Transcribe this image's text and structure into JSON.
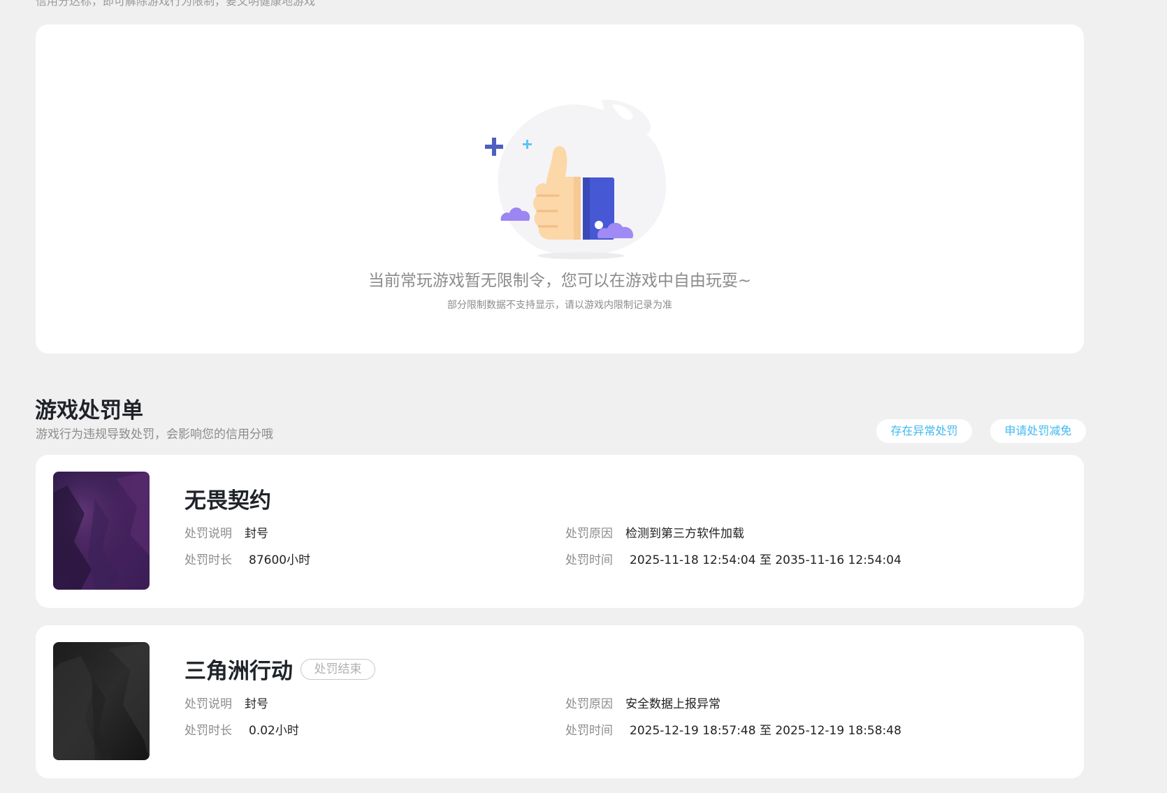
{
  "top_hint": "信用分达标，即可解除游戏行为限制，要文明健康地游戏",
  "empty_state": {
    "message": "当前常玩游戏暂无限制令，您可以在游戏中自由玩耍~",
    "note": "部分限制数据不支持显示，请以游戏内限制记录为准",
    "illustration_icon": "thumbs-up-icon"
  },
  "penalty_section": {
    "title": "游戏处罚单",
    "subtitle": "游戏行为违规导致处罚，会影响您的信用分哦",
    "anomaly_button": "存在异常处罚",
    "appeal_button": "申请处罚减免"
  },
  "labels": {
    "desc": "处罚说明",
    "duration": "处罚时长",
    "reason": "处罚原因",
    "time": "处罚时间"
  },
  "penalties": [
    {
      "game": "无畏契约",
      "status": "",
      "desc": "封号",
      "duration": "87600小时",
      "reason": "检测到第三方软件加载",
      "time": "2025-11-18 12:54:04 至 2035-11-16 12:54:04"
    },
    {
      "game": "三角洲行动",
      "status": "处罚结束",
      "desc": "封号",
      "duration": "0.02小时",
      "reason": "安全数据上报异常",
      "time": "2025-12-19 18:57:48 至 2025-12-19 18:58:48"
    }
  ],
  "colors": {
    "background": "#f0f0f0",
    "card": "#ffffff",
    "accent": "#3fb8f2",
    "muted": "#8c8c8c",
    "title": "#1f2329"
  }
}
